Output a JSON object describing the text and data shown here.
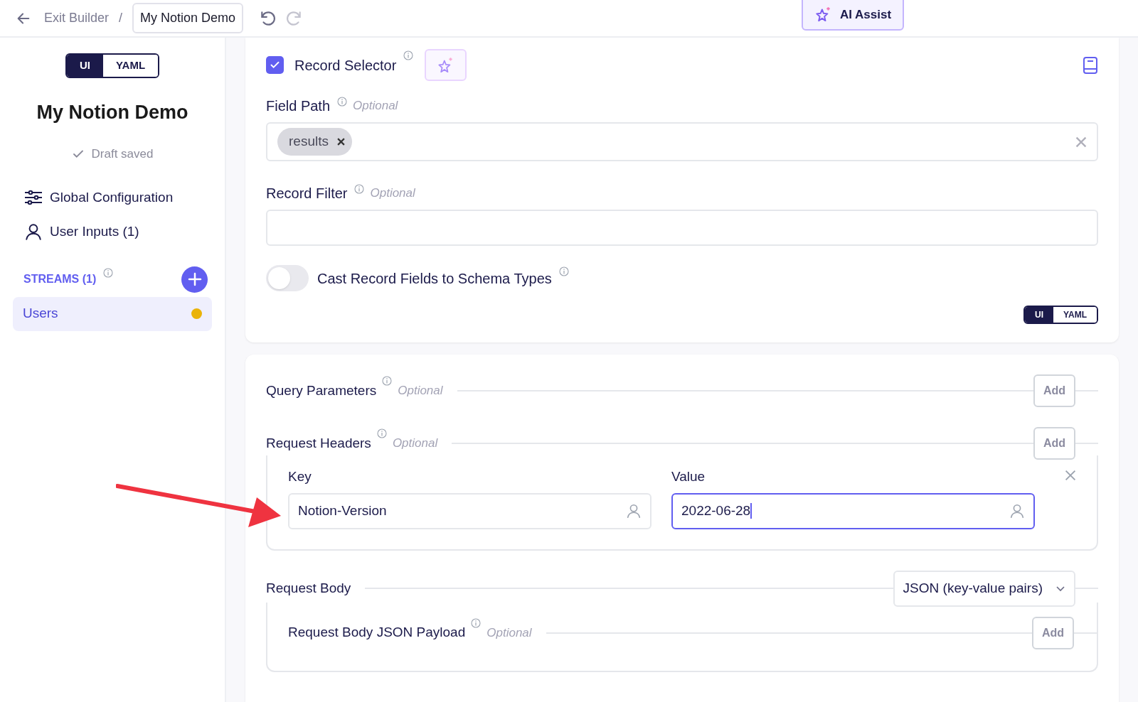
{
  "topbar": {
    "back_label": "Exit Builder",
    "separator": "/",
    "project_name": "My Notion Demo",
    "ai_assist": "AI Assist"
  },
  "sidebar": {
    "view_toggle": [
      {
        "label": "UI",
        "selected": true
      },
      {
        "label": "YAML",
        "selected": false
      }
    ],
    "title": "My Notion Demo",
    "status": "Draft saved",
    "nav": [
      {
        "kind": "config",
        "label": "Global Configuration"
      },
      {
        "kind": "user",
        "label": "User Inputs (1)"
      }
    ],
    "streams_label": "STREAMS (1)",
    "streams": [
      {
        "name": "Users",
        "selected": true,
        "color": "#eab308"
      }
    ]
  },
  "record_selector": {
    "label": "Record Selector",
    "checked": true,
    "field_path": {
      "label": "Field Path",
      "hint": "Optional",
      "tags": [
        "results"
      ]
    },
    "record_filter": {
      "label": "Record Filter",
      "hint": "Optional"
    },
    "cast": {
      "label": "Cast Record Fields to Schema Types",
      "on": false
    },
    "view_toggle": [
      {
        "label": "UI",
        "selected": true
      },
      {
        "label": "YAML",
        "selected": false
      }
    ]
  },
  "request": {
    "query_parameters": {
      "label": "Query Parameters",
      "hint": "Optional",
      "button": "Add"
    },
    "request_headers": {
      "label": "Request Headers",
      "hint": "Optional",
      "button": "Add",
      "rows": [
        {
          "fields": [
            {
              "label": "Key",
              "value": "Notion-Version",
              "focused": false
            },
            {
              "label": "Value",
              "value": "2022-06-28",
              "focused": true
            }
          ]
        }
      ]
    },
    "request_body": {
      "label": "Request Body",
      "type": "JSON (key-value pairs)",
      "payload": {
        "label": "Request Body JSON Payload",
        "hint": "Optional",
        "button": "Add"
      }
    }
  }
}
